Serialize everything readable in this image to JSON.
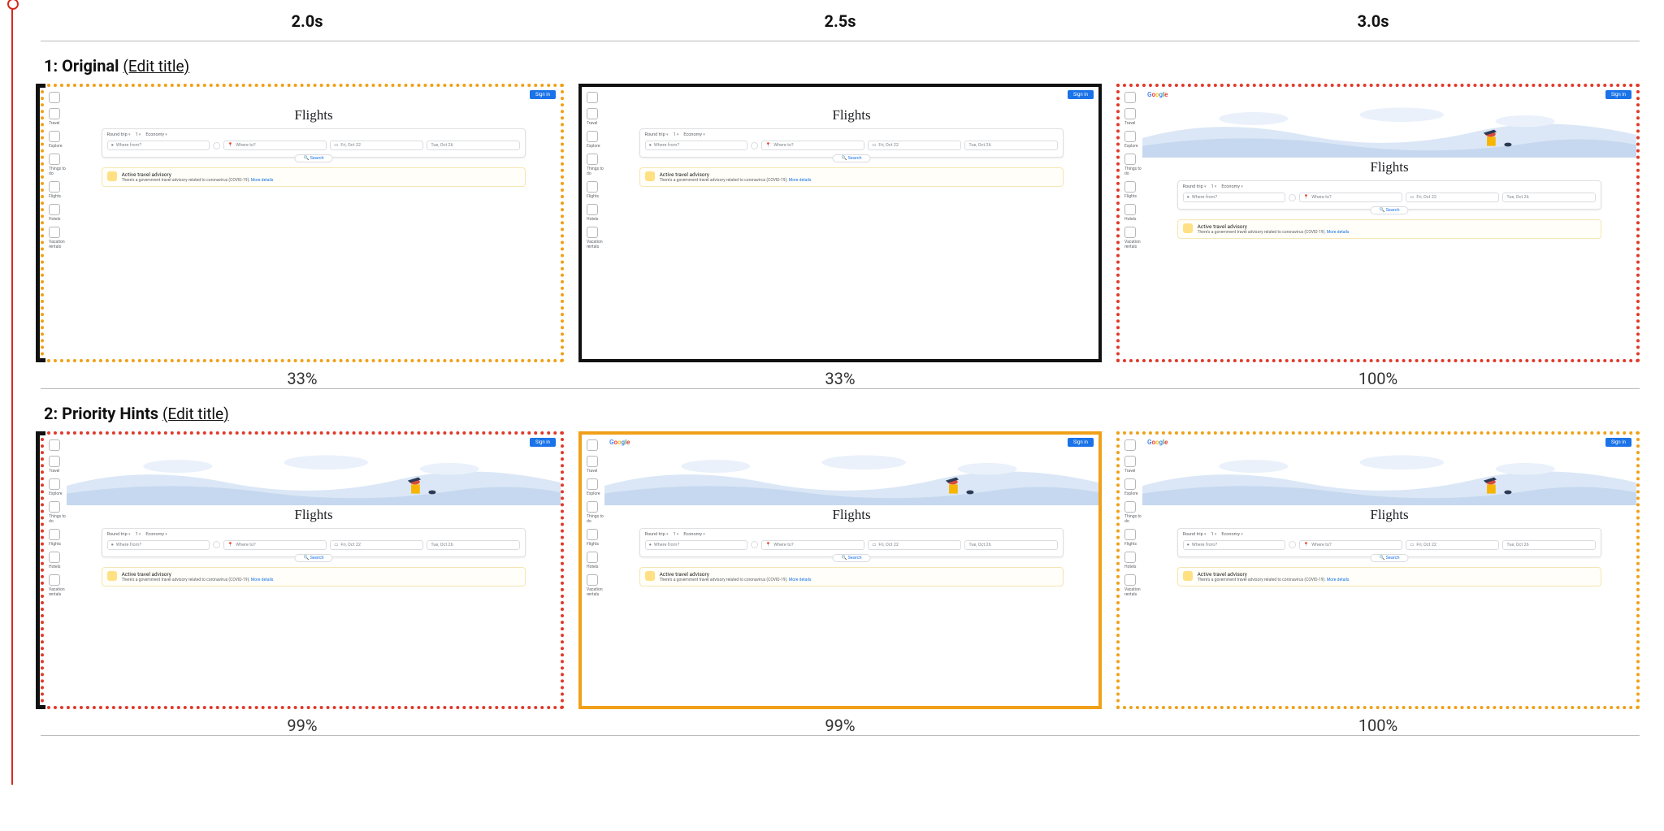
{
  "timeline": {
    "times": [
      "2.0s",
      "2.5s",
      "3.0s"
    ]
  },
  "rows": [
    {
      "index_label": "1:",
      "title": "Original",
      "edit": "(Edit title)",
      "percents": [
        "33%",
        "33%",
        "100%"
      ],
      "frame_border": [
        "dotted-orange",
        "solid-black",
        "dotted-red"
      ],
      "show_hero": [
        false,
        false,
        true
      ],
      "show_logo": [
        false,
        false,
        true
      ],
      "left_bracket": true
    },
    {
      "index_label": "2:",
      "title": "Priority Hints",
      "edit": "(Edit title)",
      "percents": [
        "99%",
        "99%",
        "100%"
      ],
      "frame_border": [
        "dotted-red",
        "solid-orange",
        "dotted-orange"
      ],
      "show_hero": [
        true,
        true,
        true
      ],
      "show_logo": [
        false,
        true,
        true
      ],
      "left_bracket": true
    }
  ],
  "mini": {
    "signin": "Sign in",
    "logo_letters": [
      "G",
      "o",
      "o",
      "g",
      "l",
      "e"
    ],
    "nav_items": [
      "Travel",
      "Explore",
      "Things to do",
      "Flights",
      "Hotels",
      "Vacation rentals"
    ],
    "title": "Flights",
    "chips": [
      "Round trip",
      "1",
      "Economy"
    ],
    "where_from": "Where from?",
    "where_to": "Where to?",
    "date_from": "Fri, Oct 22",
    "date_to": "Tue, Oct 26",
    "search": "Search",
    "advisory_title": "Active travel advisory",
    "advisory_sub": "There's a government travel advisory related to coronavirus (COVID-19). ",
    "advisory_link": "More details"
  }
}
